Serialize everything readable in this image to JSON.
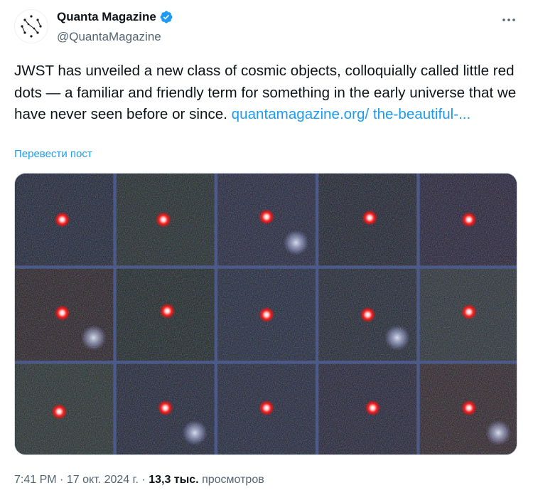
{
  "author": {
    "name": "Quanta Magazine",
    "handle": "@QuantaMagazine",
    "verified": true,
    "avatar_icon": "quanta-logo-icon"
  },
  "tweet": {
    "text": "JWST has unveiled a new class of cosmic objects, colloquially called little red dots — a familiar and friendly term for something in the early universe that we have never seen before or since. ",
    "link_text": "quantamagazine.org/ the-beautiful-...",
    "translate_label": "Перевести пост"
  },
  "media": {
    "alt_name": "little-red-dots-grid",
    "rows": 3,
    "columns": 5
  },
  "meta": {
    "time": "7:41 PM",
    "separator": "·",
    "date": "17 окт. 2024 г.",
    "views_count": "13,3 тыс.",
    "views_label": "просмотров"
  },
  "colors": {
    "link": "#1d9bf0",
    "secondary_text": "#536471",
    "verified_badge": "#1d9bf0",
    "grid_line": "#4a5a8c"
  },
  "icons": [
    "quanta-logo-icon",
    "verified-badge-icon",
    "more-options-icon"
  ]
}
